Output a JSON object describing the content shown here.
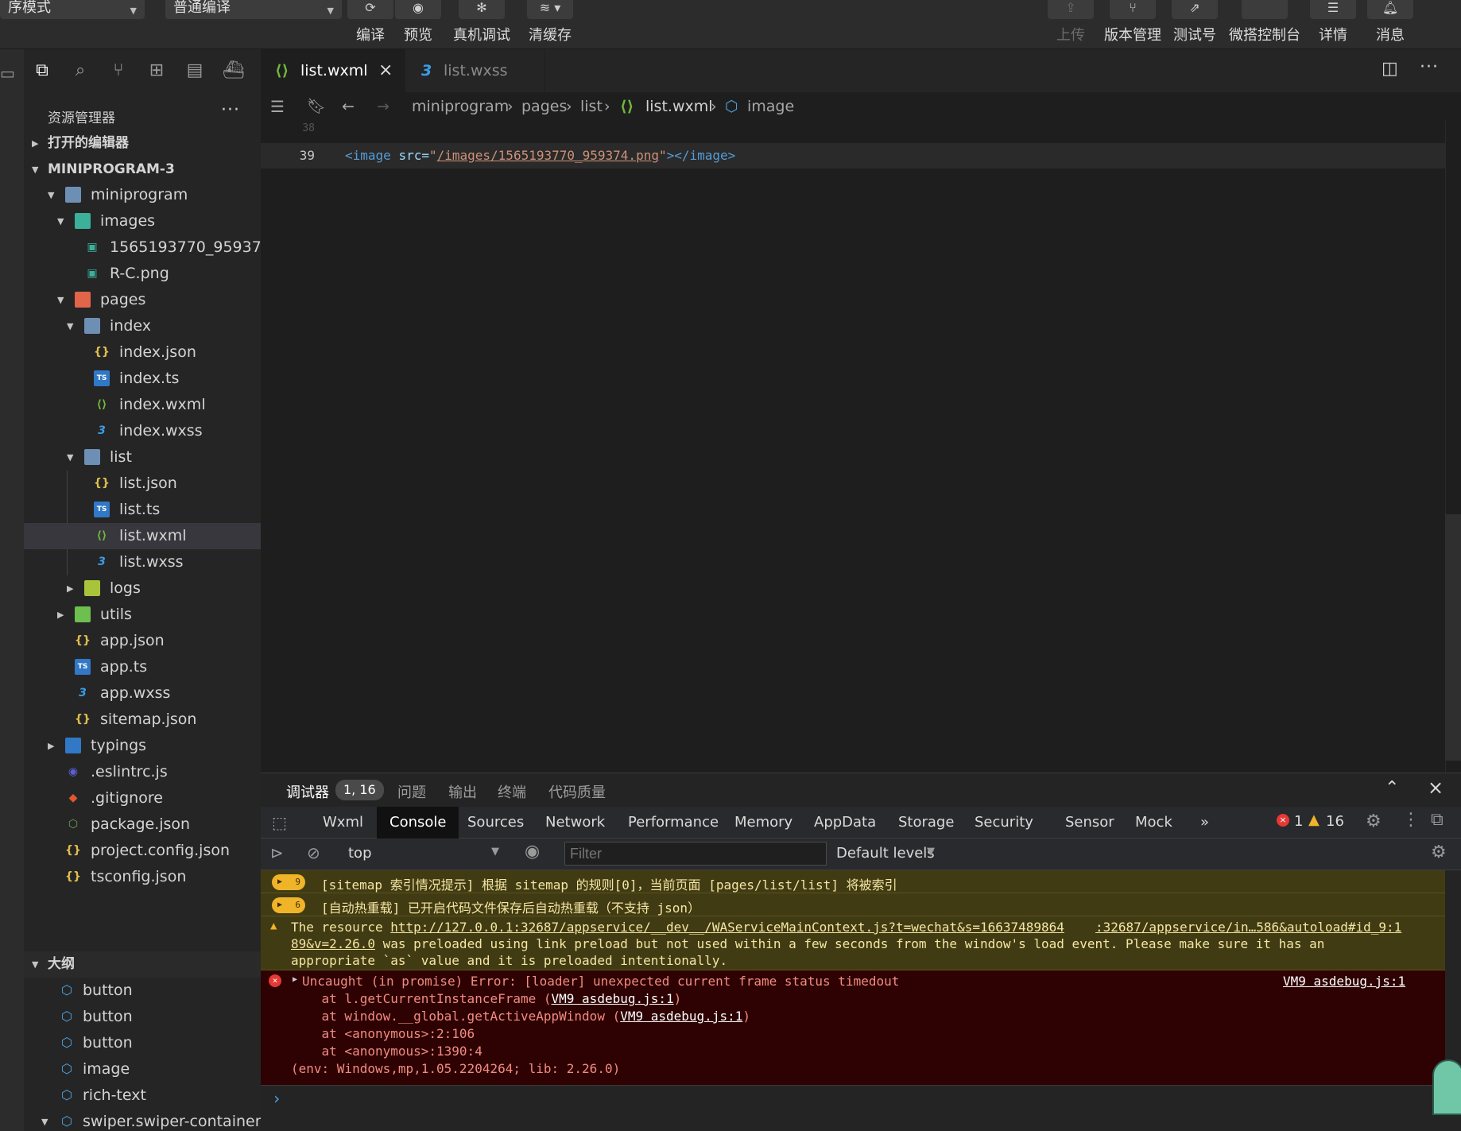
{
  "toolbar": {
    "mode_select": "序模式",
    "compile_select": "普通编译",
    "buttons": {
      "compile": "编译",
      "preview": "预览",
      "real_debug": "真机调试",
      "clear_cache": "清缓存",
      "upload": "上传",
      "version": "版本管理",
      "test_account": "测试号",
      "cloud_console": "微搭控制台",
      "details": "详情",
      "messages": "消息"
    }
  },
  "explorer": {
    "title": "资源管理器",
    "more": "···",
    "open_editors": "打开的编辑器",
    "project": "MINIPROGRAM-3",
    "tree": {
      "miniprogram": "miniprogram",
      "images": "images",
      "img1": "1565193770_95937...",
      "img2": "R-C.png",
      "pages": "pages",
      "index": "index",
      "index_json": "index.json",
      "index_ts": "index.ts",
      "index_wxml": "index.wxml",
      "index_wxss": "index.wxss",
      "list": "list",
      "list_json": "list.json",
      "list_ts": "list.ts",
      "list_wxml": "list.wxml",
      "list_wxss": "list.wxss",
      "logs": "logs",
      "utils": "utils",
      "app_json": "app.json",
      "app_ts": "app.ts",
      "app_wxss": "app.wxss",
      "sitemap_json": "sitemap.json",
      "typings": "typings",
      "eslintrc": ".eslintrc.js",
      "gitignore": ".gitignore",
      "package_json": "package.json",
      "project_config": "project.config.json",
      "tsconfig": "tsconfig.json"
    },
    "outline_title": "大纲",
    "outline": {
      "o1": "button",
      "o2": "button",
      "o3": "button",
      "o4": "image",
      "o5": "rich-text",
      "o6": "swiper.swiper-container"
    }
  },
  "editor": {
    "tabs": {
      "active": "list.wxml",
      "other": "list.wxss"
    },
    "breadcrumb": {
      "c1": "miniprogram",
      "c2": "pages",
      "c3": "list",
      "c4": "list.wxml",
      "c5": "image"
    },
    "lines": {
      "prev_no": "38",
      "cur_no": "39",
      "tag_open": "<image",
      "attr": "src=",
      "quote": "\"",
      "value": "/images/1565193770_959374.png",
      "tag_close": "></image>"
    }
  },
  "debugger": {
    "tabs": {
      "debugger": "调试器",
      "badge": "1, 16",
      "issues": "问题",
      "output": "输出",
      "terminal": "终端",
      "code_quality": "代码质量"
    },
    "devtools": {
      "wxml": "Wxml",
      "console": "Console",
      "sources": "Sources",
      "network": "Network",
      "performance": "Performance",
      "memory": "Memory",
      "appdata": "AppData",
      "storage": "Storage",
      "security": "Security",
      "sensor": "Sensor",
      "mock": "Mock",
      "more": "»",
      "err_count": "1",
      "warn_count": "16"
    },
    "console_bar": {
      "context": "top",
      "filter_placeholder": "Filter",
      "levels": "Default levels"
    },
    "messages": {
      "m1_count": "9",
      "m1_text": "[sitemap 索引情况提示] 根据 sitemap 的规则[0]，当前页面 [pages/list/list] 将被索引",
      "m2_count": "6",
      "m2_text": "[自动热重载] 已开启代码文件保存后自动热重载（不支持 json）",
      "m3_a": "The resource ",
      "m3_url": "http://127.0.0.1:32687/appservice/__dev__/WAServiceMainContext.js?t=wechat&s=16637489864",
      "m3_src": ":32687/appservice/in…586&autoload#id_9:1",
      "m3_url2": "89&v=2.26.0",
      "m3_b": " was preloaded using link preload but not used within a few seconds from the window's load event. Please make sure it has an",
      "m3_c": "appropriate `as` value and it is preloaded intentionally.",
      "e1": "Uncaught (in promise) Error: [loader] unexpected current frame status timedout",
      "e1_src": "VM9 asdebug.js:1",
      "e2a": "    at l.getCurrentInstanceFrame (",
      "e2l": "VM9 asdebug.js:1",
      "e2b": ")",
      "e3a": "    at window.__global.getActiveAppWindow (",
      "e3l": "VM9 asdebug.js:1",
      "e3b": ")",
      "e4": "    at <anonymous>:2:106",
      "e5": "    at <anonymous>:1390:4",
      "e6": "(env: Windows,mp,1.05.2204264; lib: 2.26.0)",
      "prompt": "›"
    }
  }
}
